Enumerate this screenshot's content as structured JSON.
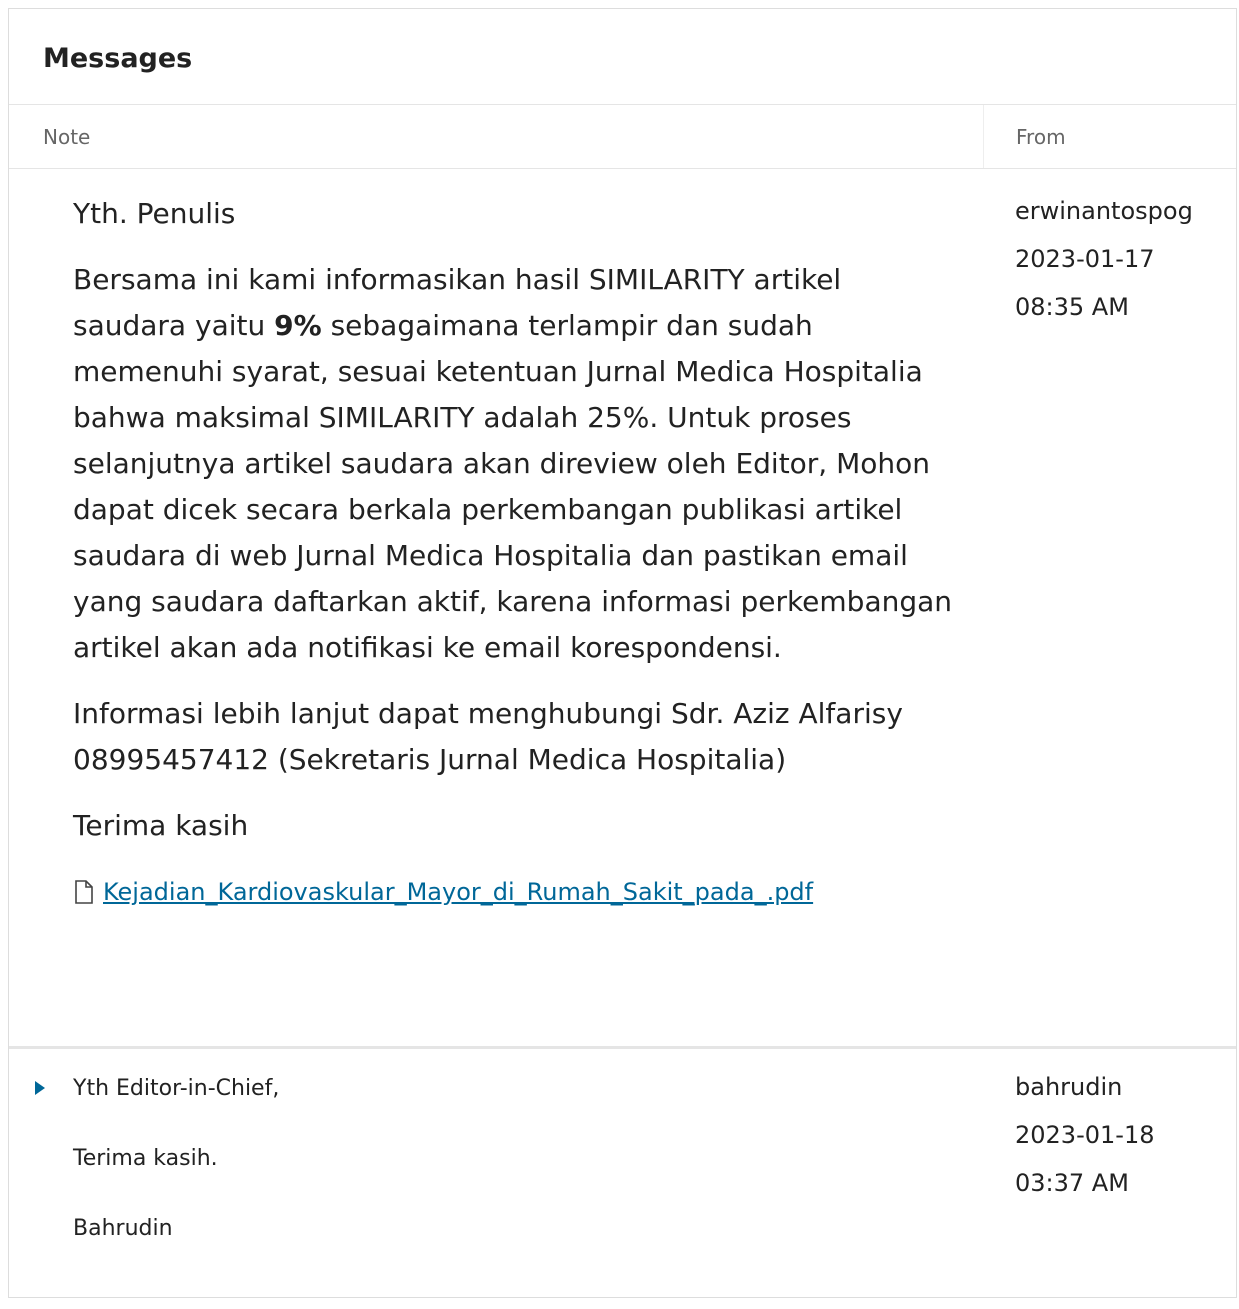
{
  "panel": {
    "title": "Messages"
  },
  "columns": {
    "note": "Note",
    "from": "From"
  },
  "messages": [
    {
      "paragraphs": {
        "greeting": "Yth. Penulis",
        "body_pre": "Bersama ini kami informasikan hasil SIMILARITY artikel saudara yaitu ",
        "body_bold": "9%",
        "body_post": " sebagaimana terlampir dan sudah memenuhi syarat, sesuai ketentuan Jurnal Medica Hospitalia bahwa maksimal SIMILARITY adalah 25%. Untuk proses selanjutnya artikel saudara akan direview oleh Editor, Mohon dapat dicek secara berkala perkembangan publikasi artikel saudara di web Jurnal Medica Hospitalia dan pastikan email yang saudara daftarkan aktif, karena informasi perkembangan artikel akan ada notifikasi ke email korespondensi.",
        "info": "Informasi lebih lanjut dapat menghubungi Sdr. Aziz Alfarisy 08995457412 (Sekretaris Jurnal Medica Hospitalia)",
        "closing": "Terima kasih"
      },
      "attachment": "Kejadian_Kardiovaskular_Mayor_di_Rumah_Sakit_pada_.pdf",
      "from": {
        "user": "erwinantospog",
        "date": "2023-01-17",
        "time": "08:35 AM"
      }
    },
    {
      "paragraphs": {
        "greeting": "Yth Editor-in-Chief,",
        "line2": "Terima kasih.",
        "signature": "Bahrudin"
      },
      "from": {
        "user": "bahrudin",
        "date": "2023-01-18",
        "time": "03:37 AM"
      }
    }
  ],
  "colors": {
    "link": "#006798",
    "border": "#e5e5e5"
  }
}
